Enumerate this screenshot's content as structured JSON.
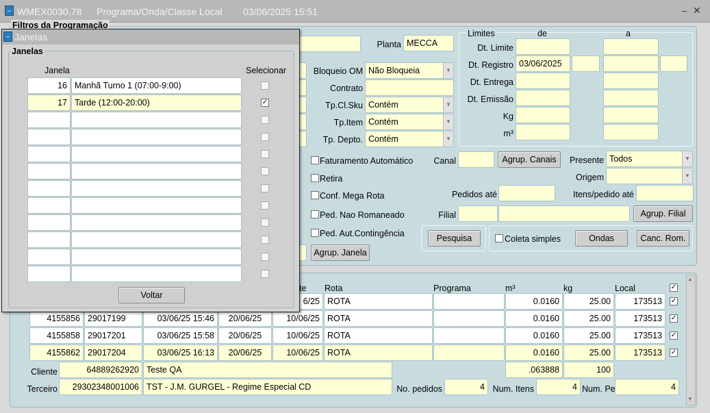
{
  "window": {
    "form_id": "WMEX0030.78",
    "title": "Programa/Onda/Classe Local",
    "date": "03/06/2025 15:51",
    "minimize": "–",
    "close": "✕"
  },
  "filters": {
    "group_label": "Filtros da Programação",
    "planta_label": "Planta",
    "planta_value": "MECCA",
    "limites_label": "Limites",
    "de_label": "de",
    "a_label": "a",
    "dt_limite_label": "Dt. Limite",
    "dt_registro_label": "Dt. Registro",
    "dt_registro_de": "03/06/2025",
    "dt_entrega_label": "Dt. Entrega",
    "dt_emissao_label": "Dt. Emissão",
    "kg_label": "Kg",
    "m3_label": "m³",
    "bloqueio_label": "Bloqueio OM",
    "bloqueio_value": "Não Bloqueia",
    "contrato_label": "Contrato",
    "tpclsku_label": "Tp.Cl.Sku",
    "tpclsku_value": "Contém",
    "tpitem_label": "Tp.Item",
    "tpitem_value": "Contém",
    "tpdepto_label": "Tp. Depto.",
    "tpdepto_value": "Contém",
    "fat_auto_label": "Faturamento Automático",
    "retira_label": "Retira",
    "conf_mega_label": "Conf. Mega Rota",
    "ped_nao_rom_label": "Ped. Nao Romaneado",
    "ped_aut_cont_label": "Ped. Aut.Contingência",
    "agrup_janela_label": "Agrup. Janela",
    "canal_label": "Canal",
    "agrup_canais_label": "Agrup. Canais",
    "presente_label": "Presente",
    "presente_value": "Todos",
    "origem_label": "Origem",
    "pedidos_ate_label": "Pedidos até",
    "itens_pedido_label": "Itens/pedido até",
    "filial_label": "Filial",
    "agrup_filial_label": "Agrup. Filial",
    "pesquisa_label": "Pesquisa",
    "coleta_simples_label": "Coleta simples",
    "ondas_label": "Ondas",
    "canc_rom_label": "Canc. Rom."
  },
  "results": {
    "headers": {
      "te": "te",
      "rota": "Rota",
      "programa": "Programa",
      "m3": "m³",
      "kg": "kg",
      "local": "Local"
    },
    "rows": [
      {
        "pedido": "",
        "om": "",
        "data_reg": "",
        "data_lim": "",
        "data_ent": "6/25",
        "rota": "ROTA",
        "programa": "",
        "m3": "0.0160",
        "kg": "25.00",
        "local": "173513",
        "sel": true,
        "hl": false
      },
      {
        "pedido": "4155856",
        "om": "29017199",
        "data_reg": "03/06/25 15:46",
        "data_lim": "20/06/25",
        "data_ent": "10/06/25",
        "rota": "ROTA",
        "programa": "",
        "m3": "0.0160",
        "kg": "25.00",
        "local": "173513",
        "sel": true,
        "hl": false
      },
      {
        "pedido": "4155858",
        "om": "29017201",
        "data_reg": "03/06/25 15:58",
        "data_lim": "20/06/25",
        "data_ent": "10/06/25",
        "rota": "ROTA",
        "programa": "",
        "m3": "0.0160",
        "kg": "25.00",
        "local": "173513",
        "sel": true,
        "hl": false
      },
      {
        "pedido": "4155862",
        "om": "29017204",
        "data_reg": "03/06/25 16:13",
        "data_lim": "20/06/25",
        "data_ent": "10/06/25",
        "rota": "ROTA",
        "programa": "",
        "m3": "0.0160",
        "kg": "25.00",
        "local": "173513",
        "sel": true,
        "hl": true
      }
    ],
    "cliente_label": "Cliente",
    "cliente_code": "64889262920",
    "cliente_name": "Teste QA",
    "total_m3": ".063888",
    "total_kg": "100",
    "terceiro_label": "Terceiro",
    "terceiro_code": "29302348001006",
    "terceiro_name": "TST - J.M. GURGEL - Regime Especial CD",
    "no_pedidos_label": "No. pedidos",
    "no_pedidos": "4",
    "num_itens_label": "Num. Itens",
    "num_itens": "4",
    "num_pecas_label": "Num. Peças",
    "num_pecas": "4"
  },
  "dialog": {
    "title": "Janelas",
    "group_label": "Janelas",
    "col_janela": "Janela",
    "col_selecionar": "Selecionar",
    "rows": [
      {
        "num": "16",
        "desc": "Manhã Turno 1 (07:00-9:00)",
        "checked": false,
        "hl": false
      },
      {
        "num": "17",
        "desc": "Tarde (12:00-20:00)",
        "checked": true,
        "hl": true
      },
      {
        "num": "",
        "desc": "",
        "checked": false,
        "hl": false
      },
      {
        "num": "",
        "desc": "",
        "checked": false,
        "hl": false
      },
      {
        "num": "",
        "desc": "",
        "checked": false,
        "hl": false
      },
      {
        "num": "",
        "desc": "",
        "checked": false,
        "hl": false
      },
      {
        "num": "",
        "desc": "",
        "checked": false,
        "hl": false
      },
      {
        "num": "",
        "desc": "",
        "checked": false,
        "hl": false
      },
      {
        "num": "",
        "desc": "",
        "checked": false,
        "hl": false
      },
      {
        "num": "",
        "desc": "",
        "checked": false,
        "hl": false
      },
      {
        "num": "",
        "desc": "",
        "checked": false,
        "hl": false
      },
      {
        "num": "",
        "desc": "",
        "checked": false,
        "hl": false
      }
    ],
    "voltar_label": "Voltar"
  }
}
